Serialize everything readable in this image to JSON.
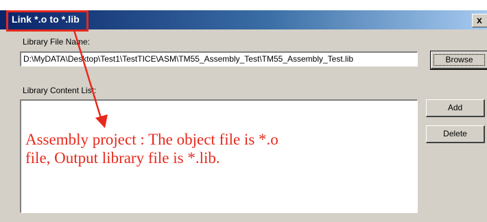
{
  "window": {
    "title": "Link *.o to *.lib",
    "close_glyph": "x"
  },
  "library_file": {
    "label": "Library File Name:",
    "value": "D:\\MyDATA\\Desktop\\Test1\\TestTICE\\ASM\\TM55_Assembly_Test\\TM55_Assembly_Test.lib",
    "browse_label": "Browse"
  },
  "content_list": {
    "label": "Library Content List:",
    "add_label": "Add",
    "delete_label": "Delete"
  },
  "annotation": {
    "text": "Assembly project  : The object  file is *.o\nfile, Output  library file is *.lib.",
    "color": "#e8281c"
  }
}
